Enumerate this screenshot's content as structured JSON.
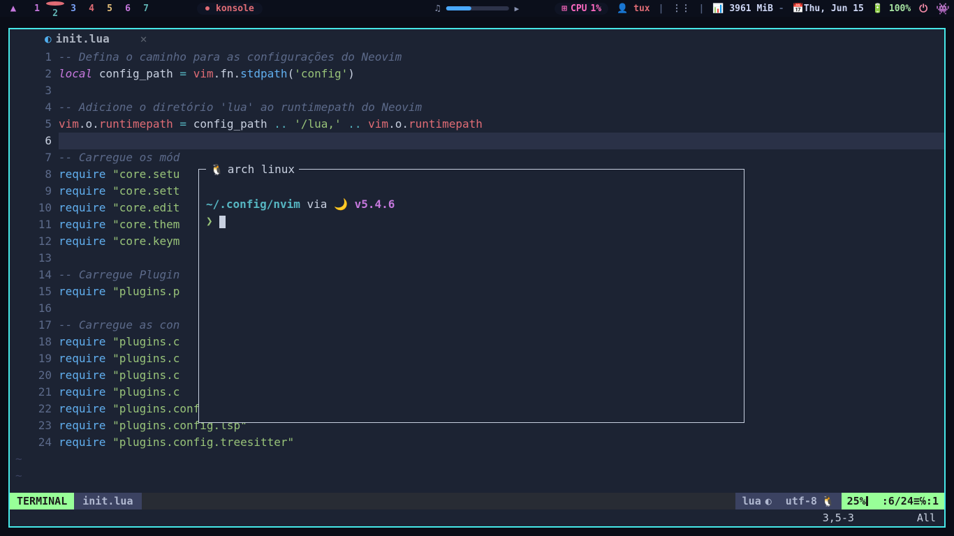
{
  "polybar": {
    "workspaces": [
      "1",
      "2",
      "3",
      "4",
      "5",
      "6",
      "7"
    ],
    "app_name": "konsole",
    "cpu_label": "CPU",
    "cpu_value": "1%",
    "user": "tux",
    "mem": "3961 MiB",
    "mem_sep": "-",
    "date": "Thu, Jun 15",
    "battery": "100%"
  },
  "tab": {
    "filename": "init.lua"
  },
  "code": {
    "l1": "-- Defina o caminho para as configurações do Neovim",
    "l2_local": "local",
    "l2_id": "config_path",
    "l2_eq": " = ",
    "l2_vim": "vim",
    "l2_fn": ".fn.",
    "l2_std": "stdpath",
    "l2_p1": "(",
    "l2_s": "'config'",
    "l2_p2": ")",
    "l4": "-- Adicione o diretório 'lua' ao runtimepath do Neovim",
    "l5_pre": "vim",
    "l5_o": ".o.",
    "l5_rt": "runtimepath",
    "l5_eq": " = ",
    "l5_cp": "config_path",
    "l5_cc": " .. ",
    "l5_s": "'/lua,'",
    "l5_cc2": " .. ",
    "l5_vim2": "vim",
    "l5_o2": ".o.",
    "l5_rt2": "runtimepath",
    "l7": "-- Carregue os mód",
    "l8r": "require ",
    "l8s": "\"core.setu",
    "l9r": "require ",
    "l9s": "\"core.sett",
    "l10r": "require ",
    "l10s": "\"core.edit",
    "l11r": "require ",
    "l11s": "\"core.them",
    "l12r": "require ",
    "l12s": "\"core.keym",
    "l14": "-- Carregue Plugin",
    "l15r": "require ",
    "l15s": "\"plugins.p",
    "l17": "-- Carregue as con",
    "l18r": "require ",
    "l18s": "\"plugins.c",
    "l19r": "require ",
    "l19s": "\"plugins.c",
    "l20r": "require ",
    "l20s": "\"plugins.c",
    "l21r": "require ",
    "l21s": "\"plugins.c",
    "l22r": "require ",
    "l22s": "\"plugins.config.autopairs\"",
    "l23r": "require ",
    "l23s": "\"plugins.config.lsp\"",
    "l24r": "require ",
    "l24s": "\"plugins.config.treesitter\""
  },
  "float": {
    "title": "arch linux",
    "path": "~/.config/nvim",
    "via": "via",
    "version": "v5.4.6",
    "prompt": "❯"
  },
  "status": {
    "mode": "TERMINAL",
    "file": "init.lua",
    "filetype": "lua",
    "encoding": "utf-8",
    "percent": "25%",
    "position": ":6/24≡℅:1",
    "ruler": "3,5-3",
    "scroll": "All"
  }
}
